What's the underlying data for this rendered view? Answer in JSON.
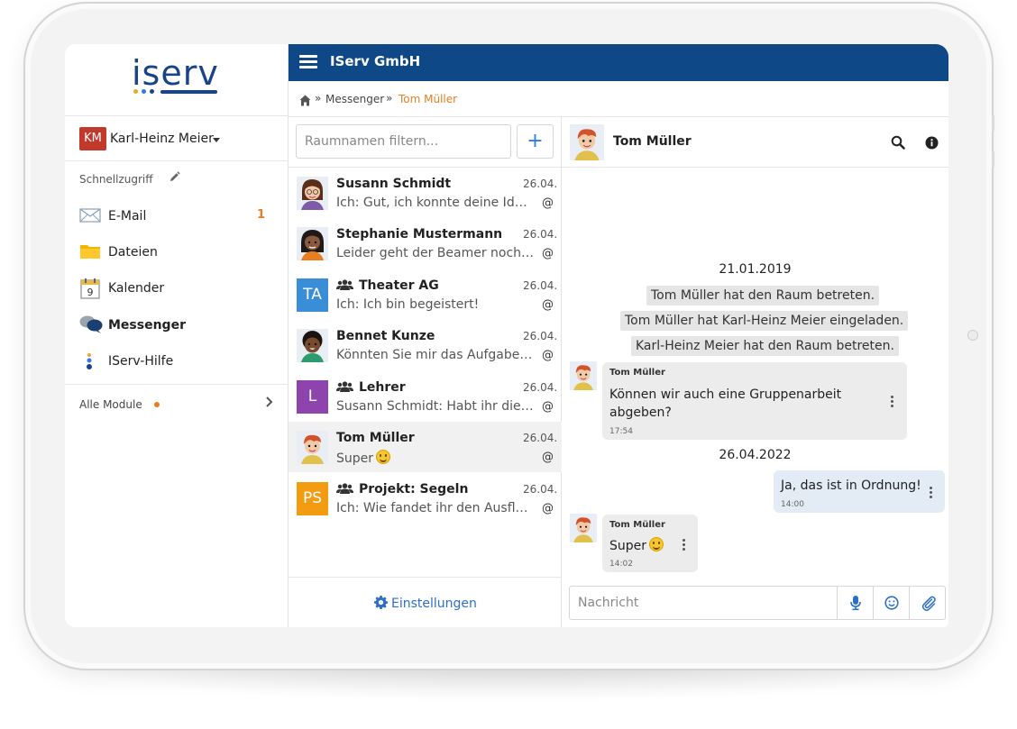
{
  "brand": {
    "logo_text": "iserv",
    "org_name": "IServ GmbH"
  },
  "user": {
    "initials": "KM",
    "name": "Karl-Heinz Meier"
  },
  "sidebar": {
    "quick_access_label": "Schnellzugriff",
    "items": [
      {
        "label": "E-Mail",
        "count": "1",
        "icon": "mail-icon"
      },
      {
        "label": "Dateien",
        "icon": "folder-icon"
      },
      {
        "label": "Kalender",
        "icon": "calendar-icon",
        "calendar_day": "9"
      },
      {
        "label": "Messenger",
        "icon": "messenger-icon"
      },
      {
        "label": "IServ-Hilfe",
        "icon": "help-icon"
      }
    ],
    "all_modules_label": "Alle Module"
  },
  "breadcrumb": {
    "sep": "»",
    "section": "Messenger",
    "current": "Tom Müller"
  },
  "rooms": {
    "filter_placeholder": "Raumnamen filtern...",
    "add_label": "+",
    "list": [
      {
        "name": "Susann Schmidt",
        "date": "26.04.",
        "preview": "Ich: Gut, ich konnte deine Ideen …",
        "at": "@",
        "group": false
      },
      {
        "name": "Stephanie Mustermann",
        "date": "26.04.",
        "preview": "Leider geht der Beamer noch ni…",
        "at": "@",
        "group": false
      },
      {
        "name": "Theater AG",
        "date": "26.04.",
        "preview": "Ich: Ich bin begeistert!",
        "at": "@",
        "group": true,
        "initials": "TA",
        "color": "#3a8ed8"
      },
      {
        "name": "Bennet Kunze",
        "date": "26.04.",
        "preview": "Könnten Sie mir das Aufgabenbl…",
        "at": "@",
        "group": false
      },
      {
        "name": "Lehrer",
        "date": "26.04.",
        "preview": "Susann Schmidt: Habt ihr die Pr…",
        "at": "@",
        "group": true,
        "initials": "L",
        "color": "#8e44ad"
      },
      {
        "name": "Tom Müller",
        "date": "26.04.",
        "preview": "Super",
        "at": "@",
        "group": false
      },
      {
        "name": "Projekt: Segeln",
        "date": "26.04.",
        "preview": "Ich: Wie fandet ihr den Ausflug?",
        "at": "@",
        "group": true,
        "initials": "PS",
        "color": "#f39c12"
      }
    ],
    "settings_label": "Einstellungen"
  },
  "chat": {
    "title": "Tom Müller",
    "date1": "21.01.2019",
    "system": [
      "Tom Müller hat den Raum betreten.",
      "Tom Müller hat Karl-Heinz Meier eingeladen.",
      "Karl-Heinz Meier hat den Raum betreten."
    ],
    "msg1": {
      "author": "Tom Müller",
      "line1": "Können wir auch eine Gruppenarbeit",
      "line2": "abgeben?",
      "time": "17:54"
    },
    "date2": "26.04.2022",
    "msg2": {
      "text": "Ja, das ist in Ordnung!",
      "time": "14:00"
    },
    "msg3": {
      "author": "Tom Müller",
      "text": "Super",
      "time": "14:02"
    },
    "composer_placeholder": "Nachricht"
  },
  "colors": {
    "brand_blue": "#0f4887",
    "accent_orange": "#e67e22",
    "link_blue": "#2d6fc4"
  }
}
